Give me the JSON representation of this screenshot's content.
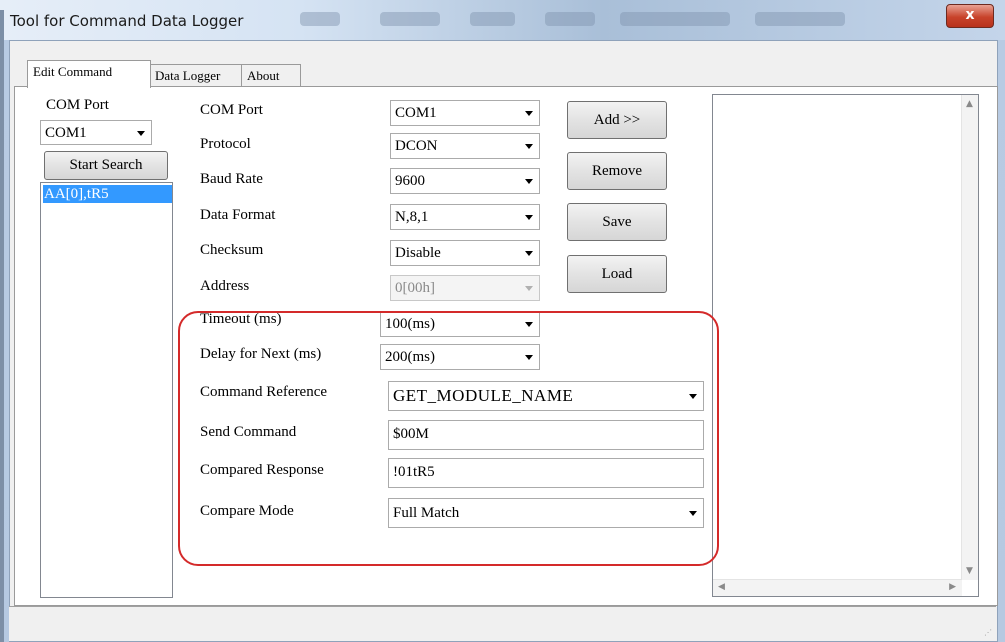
{
  "window": {
    "title": "Tool for Command Data Logger",
    "close_glyph": "x"
  },
  "tabs": [
    {
      "label": "Edit Command",
      "active": true
    },
    {
      "label": "Data Logger",
      "active": false
    },
    {
      "label": "About",
      "active": false
    }
  ],
  "left": {
    "com_label": "COM Port",
    "com_value": "COM1",
    "search_button": "Start Search",
    "results": [
      "AA[0],tR5"
    ]
  },
  "form": {
    "com_port": {
      "label": "COM Port",
      "value": "COM1"
    },
    "protocol": {
      "label": "Protocol",
      "value": "DCON"
    },
    "baud_rate": {
      "label": "Baud Rate",
      "value": "9600"
    },
    "data_format": {
      "label": "Data Format",
      "value": "N,8,1"
    },
    "checksum": {
      "label": "Checksum",
      "value": "Disable"
    },
    "address": {
      "label": "Address",
      "value": "0[00h]"
    },
    "timeout": {
      "label": "Timeout (ms)",
      "value": "100(ms)"
    },
    "delay": {
      "label": "Delay for Next (ms)",
      "value": "200(ms)"
    },
    "command_reference": {
      "label": "Command Reference",
      "value": "GET_MODULE_NAME"
    },
    "send_command": {
      "label": "Send Command",
      "value": "$00M"
    },
    "compared_response": {
      "label": "Compared Response",
      "value": "!01tR5"
    },
    "compare_mode": {
      "label": "Compare Mode",
      "value": "Full Match"
    }
  },
  "buttons": {
    "add": "Add >>",
    "remove": "Remove",
    "save": "Save",
    "load": "Load"
  },
  "colors": {
    "highlight": "#d42a2a",
    "selection": "#3399ff"
  }
}
